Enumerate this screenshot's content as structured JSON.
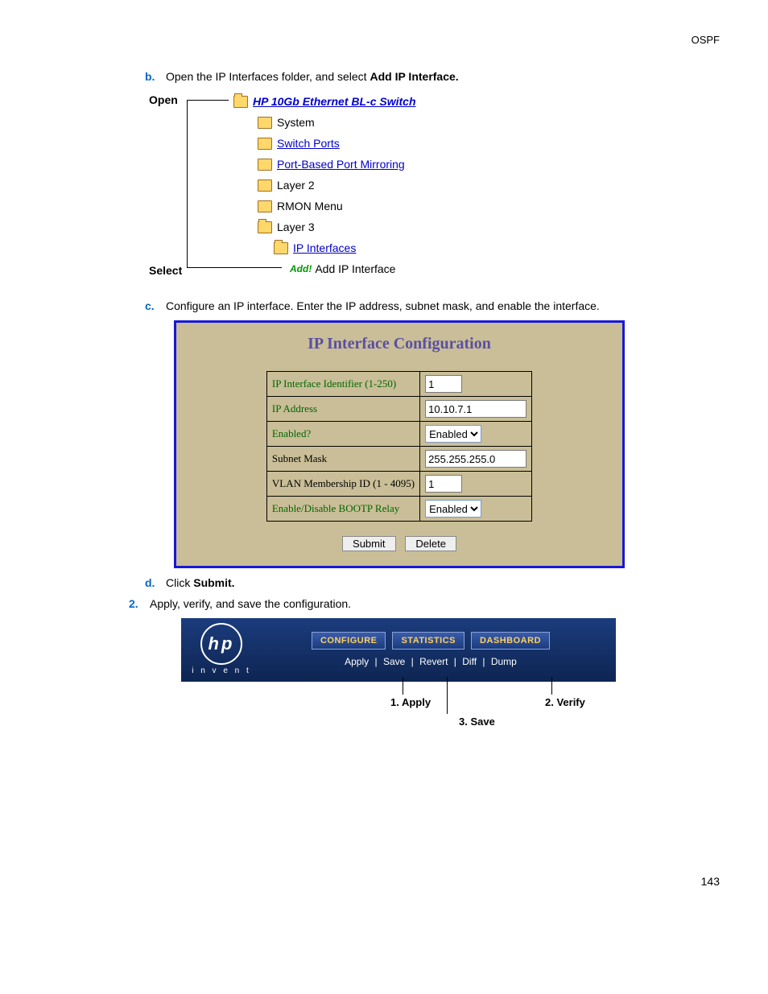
{
  "header": {
    "section": "OSPF"
  },
  "step_b": {
    "marker": "b.",
    "text_pre": "Open the IP Interfaces folder, and select ",
    "text_bold": "Add IP Interface."
  },
  "tree": {
    "open_label": "Open",
    "select_label": "Select",
    "root": "HP 10Gb Ethernet BL-c Switch",
    "items": [
      {
        "label": "System",
        "link": false
      },
      {
        "label": "Switch Ports",
        "link": true
      },
      {
        "label": "Port-Based Port Mirroring",
        "link": true
      },
      {
        "label": "Layer 2",
        "link": false
      },
      {
        "label": "RMON Menu",
        "link": false
      },
      {
        "label": "Layer 3",
        "link": false
      }
    ],
    "sub": {
      "label": "IP Interfaces",
      "link": true
    },
    "add": {
      "prefix": "Add!",
      "label": "Add IP Interface"
    }
  },
  "step_c": {
    "marker": "c.",
    "text": "Configure an IP interface. Enter the IP address, subnet mask, and enable the interface."
  },
  "config": {
    "title": "IP Interface Configuration",
    "rows": [
      {
        "label": "IP Interface Identifier (1-250)",
        "value": "1",
        "type": "text_short",
        "green": true
      },
      {
        "label": "IP Address",
        "value": "10.10.7.1",
        "type": "text_med",
        "green": true
      },
      {
        "label": "Enabled?",
        "value": "Enabled",
        "type": "select",
        "green": true
      },
      {
        "label": "Subnet Mask",
        "value": "255.255.255.0",
        "type": "text_med",
        "green": false
      },
      {
        "label": "VLAN Membership ID (1 - 4095)",
        "value": "1",
        "type": "text_short",
        "green": false
      },
      {
        "label": "Enable/Disable BOOTP Relay",
        "value": "Enabled",
        "type": "select",
        "green": true
      }
    ],
    "buttons": {
      "submit": "Submit",
      "delete": "Delete"
    }
  },
  "step_d": {
    "marker": "d.",
    "text_pre": "Click ",
    "text_bold": "Submit."
  },
  "step_2": {
    "marker": "2.",
    "text": "Apply, verify, and save the configuration."
  },
  "hpbar": {
    "logo_sub": "i n v e n t",
    "tabs": [
      "CONFIGURE",
      "STATISTICS",
      "DASHBOARD"
    ],
    "links": [
      "Apply",
      "Save",
      "Revert",
      "Diff",
      "Dump"
    ]
  },
  "annot": {
    "a1": "1. Apply",
    "a2": "2. Verify",
    "a3": "3. Save"
  },
  "page": "143"
}
